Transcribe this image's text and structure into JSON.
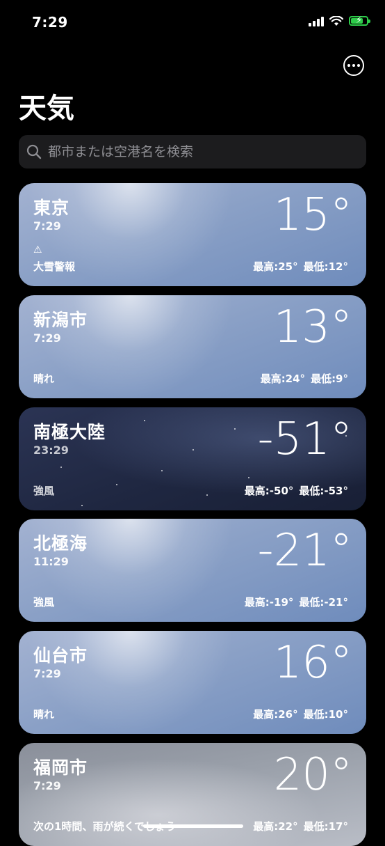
{
  "status": {
    "time": "7:29"
  },
  "title": "天気",
  "search": {
    "placeholder": "都市または空港名を検索"
  },
  "locations": [
    {
      "city": "東京",
      "time": "7:29",
      "temp": "15°",
      "condition": "大雪警報",
      "alert": true,
      "high": "最高:25°",
      "low": "最低:12°"
    },
    {
      "city": "新潟市",
      "time": "7:29",
      "temp": "13°",
      "condition": "晴れ",
      "high": "最高:24°",
      "low": "最低:9°"
    },
    {
      "city": "南極大陸",
      "time": "23:29",
      "temp": "-51°",
      "condition": "強風",
      "high": "最高:-50°",
      "low": "最低:-53°"
    },
    {
      "city": "北極海",
      "time": "11:29",
      "temp": "-21°",
      "condition": "強風",
      "high": "最高:-19°",
      "low": "最低:-21°"
    },
    {
      "city": "仙台市",
      "time": "7:29",
      "temp": "16°",
      "condition": "晴れ",
      "high": "最高:26°",
      "low": "最低:10°"
    },
    {
      "city": "福岡市",
      "time": "7:29",
      "temp": "20°",
      "condition": "次の1時間、雨が続くでしょう",
      "high": "最高:22°",
      "low": "最低:17°"
    }
  ]
}
